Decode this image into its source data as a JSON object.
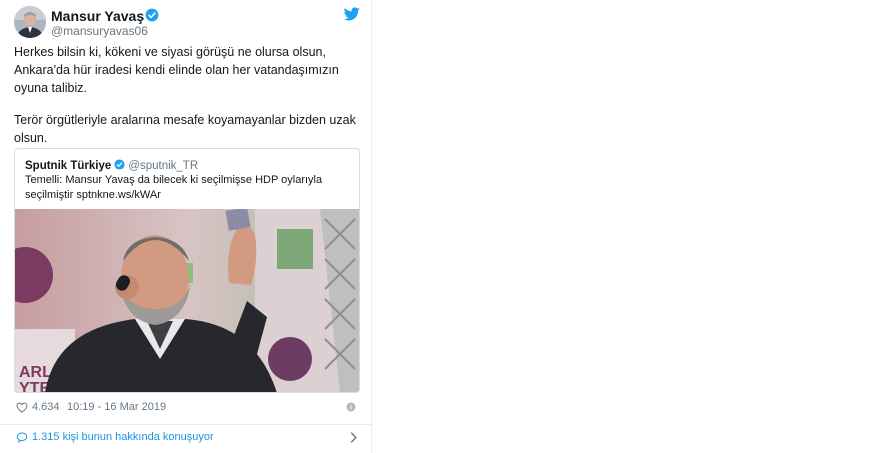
{
  "tweet": {
    "author": {
      "display_name": "Mansur Yavaş",
      "handle": "@mansuryavas06",
      "verified": true
    },
    "paragraphs": [
      "Herkes bilsin ki, kökeni ve siyasi görüşü ne olursa olsun, Ankara'da hür iradesi kendi elinde olan her vatandaşımızın oyuna talibiz.",
      "Terör örgütleriyle aralarına mesafe koyamayanlar bizden uzak olsun."
    ],
    "quoted_tweet": {
      "author_name": "Sputnik Türkiye",
      "author_handle": "@sputnik_TR",
      "verified": true,
      "text": "Temelli: Mansur Yavaş da bilecek ki seçilmişse HDP oylarıyla seçilmiştir sptnkne.ws/kWAr"
    },
    "like_count": "4.634",
    "timestamp": "10:19 - 16 Mar 2019",
    "conversation": "1.315 kişi bunun hakkında konuşuyor"
  },
  "colors": {
    "link_blue": "#1b95e0",
    "verified_blue": "#1da1f2",
    "secondary_text": "#657786",
    "primary_text": "#14171a",
    "border": "#e6ecf0"
  },
  "icons": {
    "twitter_logo": "twitter-bird-icon",
    "verified": "verified-badge-icon",
    "like": "heart-icon",
    "info": "info-icon",
    "conversation": "chat-bubble-icon",
    "chevron": "chevron-right-icon"
  }
}
